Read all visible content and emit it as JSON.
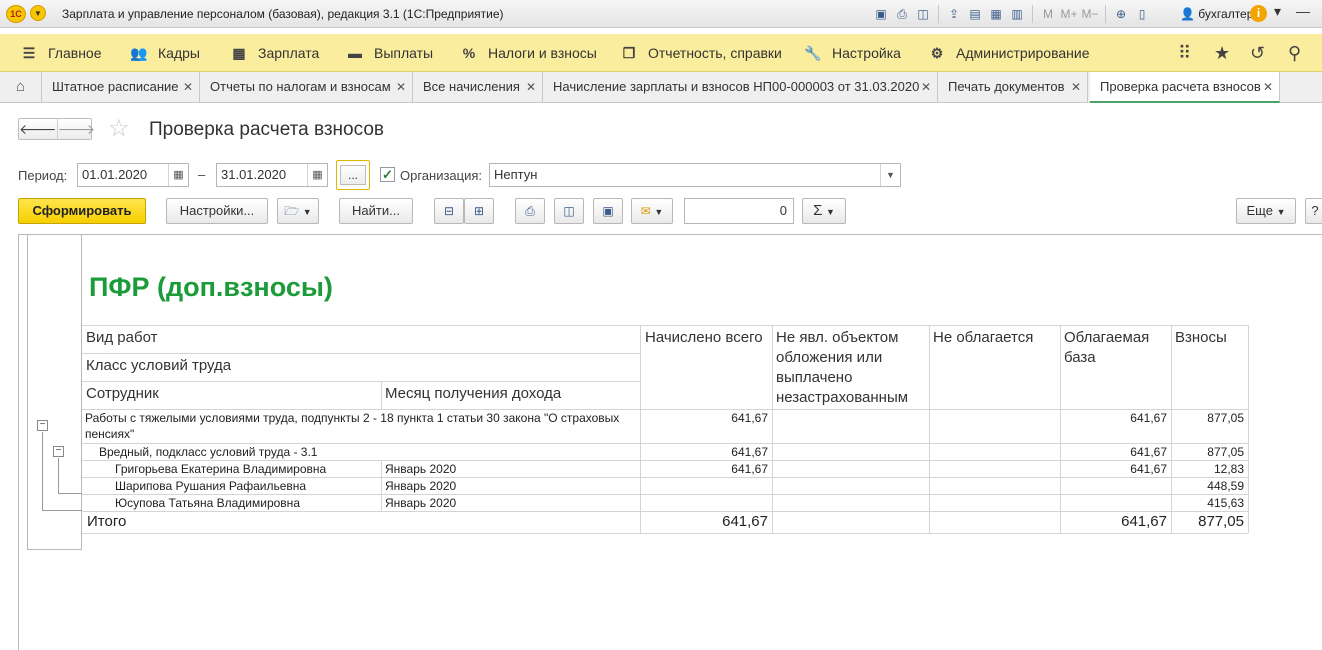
{
  "window": {
    "title": "Зарплата и управление персоналом (базовая), редакция 3.1  (1С:Предприятие)",
    "logo": "1С",
    "user": "бухгалтер"
  },
  "sections": [
    {
      "label": "Главное",
      "icon": "menu-icon"
    },
    {
      "label": "Кадры",
      "icon": "people-icon"
    },
    {
      "label": "Зарплата",
      "icon": "calculator-icon"
    },
    {
      "label": "Выплаты",
      "icon": "wallet-icon"
    },
    {
      "label": "Налоги и взносы",
      "icon": "percent-icon"
    },
    {
      "label": "Отчетность, справки",
      "icon": "reports-icon"
    },
    {
      "label": "Настройка",
      "icon": "wrench-icon"
    },
    {
      "label": "Администрирование",
      "icon": "gear-icon"
    }
  ],
  "tabs": [
    {
      "label": "Штатное расписание"
    },
    {
      "label": "Отчеты по налогам и взносам"
    },
    {
      "label": "Все начисления"
    },
    {
      "label": "Начисление зарплаты и взносов НП00-000003 от 31.03.2020"
    },
    {
      "label": "Печать документов"
    },
    {
      "label": "Проверка расчета взносов"
    }
  ],
  "form": {
    "title": "Проверка расчета взносов",
    "period_label": "Период:",
    "period_from": "01.01.2020",
    "period_dash": "–",
    "period_to": "31.01.2020",
    "period_btn": "...",
    "org_label": "Организация:",
    "org_value": "Нептун",
    "org_checked": true
  },
  "toolbar": {
    "generate": "Сформировать",
    "settings": "Настройки...",
    "find": "Найти...",
    "sum_value": "0",
    "sum_btn": "Σ",
    "more": "Еще",
    "help": "?"
  },
  "report": {
    "title": "ПФР (доп.взносы)",
    "headers": {
      "work_type": "Вид работ",
      "condition_class": "Класс условий труда",
      "employee": "Сотрудник",
      "income_month": "Месяц получения дохода",
      "accrued_total": "Начислено всего",
      "not_object": "Не явл. объектом обложения или выплачено незастрахованным",
      "not_taxed": "Не облагается",
      "taxable_base": "Облагаемая база",
      "contributions": "Взносы"
    },
    "group": {
      "label": "Работы с тяжелыми условиями труда, подпункты 2 - 18 пункта 1 статьи 30 закона \"О страховых пенсиях\"",
      "accrued": "641,67",
      "base": "641,67",
      "contrib": "877,05"
    },
    "subgroup": {
      "label": "Вредный, подкласс условий труда - 3.1",
      "accrued": "641,67",
      "base": "641,67",
      "contrib": "877,05"
    },
    "rows": [
      {
        "employee": "Григорьева Екатерина Владимировна",
        "month": "Январь 2020",
        "accrued": "641,67",
        "base": "641,67",
        "contrib": "12,83"
      },
      {
        "employee": "Шарипова Рушания Рафаильевна",
        "month": "Январь 2020",
        "accrued": "",
        "base": "",
        "contrib": "448,59"
      },
      {
        "employee": "Юсупова Татьяна Владимировна",
        "month": "Январь 2020",
        "accrued": "",
        "base": "",
        "contrib": "415,63"
      }
    ],
    "total": {
      "label": "Итого",
      "accrued": "641,67",
      "base": "641,67",
      "contrib": "877,05"
    }
  }
}
